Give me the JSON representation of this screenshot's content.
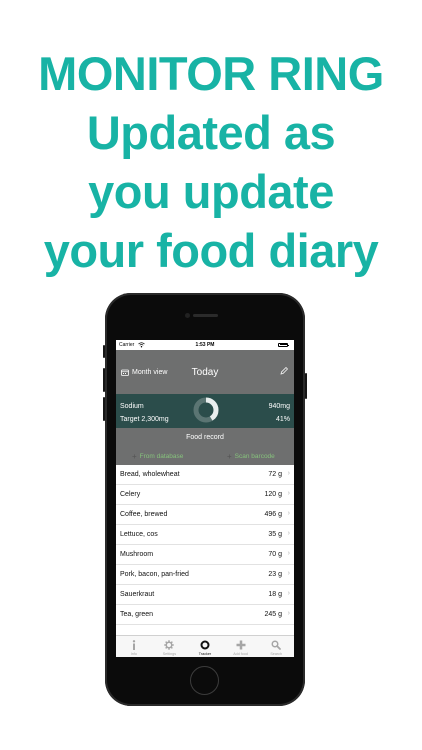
{
  "headline": {
    "line1": "MONITOR RING",
    "line2": "Updated as",
    "line3": "you update",
    "line4": "your food diary"
  },
  "colors": {
    "headline": "#18b3a5",
    "navbar": "#6e6f6f",
    "ring_row": "#2b4d4b",
    "accent_green": "#86c27c"
  },
  "status_bar": {
    "carrier": "Carrier",
    "time": "1:53 PM"
  },
  "navbar": {
    "month_view_label": "Month view",
    "title": "Today",
    "month_icon": "calendar-icon",
    "edit_icon": "pencil-icon"
  },
  "monitor": {
    "nutrient": "Sodium",
    "target": "Target 2,300mg",
    "amount": "940mg",
    "percent": "41%",
    "progress": 0.41
  },
  "food_record": {
    "title": "Food record",
    "from_database": "From database",
    "scan_barcode": "Scan barcode"
  },
  "foods": [
    {
      "name": "Bread, wholewheat",
      "qty": "72 g"
    },
    {
      "name": "Celery",
      "qty": "120 g"
    },
    {
      "name": "Coffee, brewed",
      "qty": "496 g"
    },
    {
      "name": "Lettuce, cos",
      "qty": "35 g"
    },
    {
      "name": "Mushroom",
      "qty": "70 g"
    },
    {
      "name": "Pork, bacon, pan-fried",
      "qty": "23 g"
    },
    {
      "name": "Sauerkraut",
      "qty": "18 g"
    },
    {
      "name": "Tea, green",
      "qty": "245 g"
    }
  ],
  "tabs": [
    {
      "label": "Info",
      "icon": "info-icon"
    },
    {
      "label": "Settings",
      "icon": "gear-icon"
    },
    {
      "label": "Tracker",
      "icon": "ring-icon"
    },
    {
      "label": "Add food",
      "icon": "plus-icon"
    },
    {
      "label": "Search",
      "icon": "search-icon"
    }
  ],
  "active_tab": "Tracker"
}
